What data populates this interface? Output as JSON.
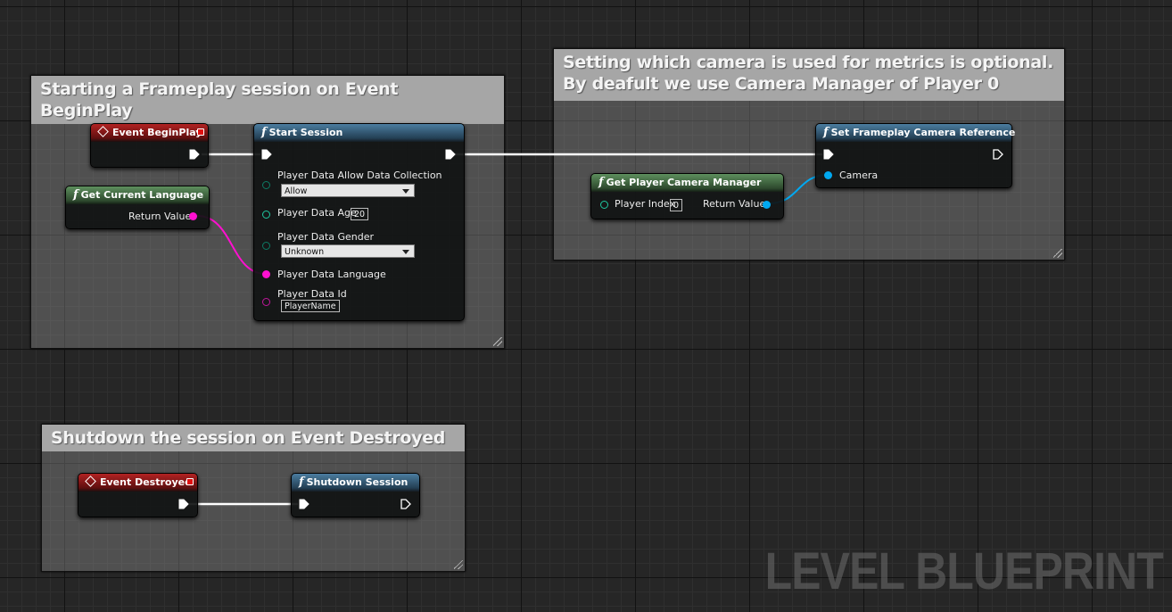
{
  "comments": {
    "begin_play": "Starting a Frameplay session on Event BeginPlay",
    "camera": "Setting which camera is used for metrics is optional.\nBy deafult we use Camera Manager of Player 0",
    "destroyed": "Shutdown the session on Event Destroyed"
  },
  "nodes": {
    "event_begin_play": {
      "title": "Event BeginPlay"
    },
    "get_current_language": {
      "title": "Get Current Language",
      "return_label": "Return Value"
    },
    "start_session": {
      "title": "Start Session",
      "allow_label": "Player Data Allow Data Collection",
      "allow_value": "Allow",
      "age_label": "Player Data Age",
      "age_value": "20",
      "gender_label": "Player Data Gender",
      "gender_value": "Unknown",
      "language_label": "Player Data Language",
      "id_label": "Player Data Id",
      "id_value": "PlayerName"
    },
    "get_player_camera_manager": {
      "title": "Get Player Camera Manager",
      "index_label": "Player Index",
      "index_value": "0",
      "return_label": "Return Value"
    },
    "set_camera_reference": {
      "title": "Set Frameplay Camera Reference",
      "camera_label": "Camera"
    },
    "event_destroyed": {
      "title": "Event Destroyed"
    },
    "shutdown_session": {
      "title": "Shutdown Session"
    }
  },
  "watermark": "LEVEL BLUEPRINT",
  "colors": {
    "exec_wire": "#ffffff",
    "string_pin": "#ff10d0",
    "object_pin": "#00a8f0",
    "byte_pin": "#00c090",
    "event_header": "#b22222",
    "function_header": "#4b7da0",
    "pure_header": "#5d8f5d"
  },
  "icons": [
    "event-diamond-icon",
    "function-f-icon",
    "exec-pin-icon",
    "data-pin-icon",
    "resize-grip-icon"
  ]
}
